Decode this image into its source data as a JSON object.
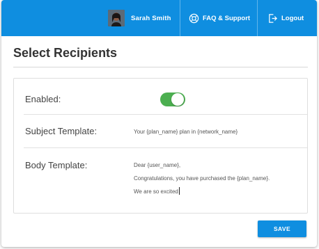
{
  "topbar": {
    "user_name": "Sarah Smith",
    "faq_label": "FAQ & Support",
    "logout_label": "Logout",
    "color": "#0f8ee0"
  },
  "header": {
    "title": "Select Recipients"
  },
  "form": {
    "enabled_label": "Enabled:",
    "enabled_value": true,
    "toggle_color": "#4caf50",
    "subject_label": "Subject Template:",
    "subject_value": "Your {plan_name} plan in {network_name}",
    "body_label": "Body Template:",
    "body_lines": [
      "Dear {user_name},",
      "Congratulations, you have purchased the {plan_name}.",
      "We are so excited"
    ]
  },
  "actions": {
    "save_label": "SAVE"
  },
  "icons": {
    "faq": "lifebuoy-icon",
    "logout": "logout-icon"
  }
}
